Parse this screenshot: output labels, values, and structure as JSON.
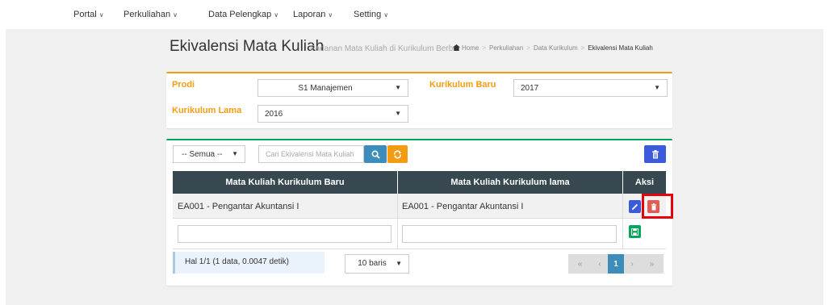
{
  "nav": {
    "items": [
      {
        "label": "Portal"
      },
      {
        "label": "Perkuliahan"
      },
      {
        "label": "Data Pelengkap"
      },
      {
        "label": "Laporan"
      },
      {
        "label": "Setting"
      }
    ]
  },
  "header": {
    "title": "Ekivalensi Mata Kuliah",
    "subtitle": "Padanan Mata Kuliah di Kurikulum Berbeda"
  },
  "breadcrumb": [
    "Home",
    "Perkuliahan",
    "Data Kurikulum",
    "Ekivalensi Mata Kuliah"
  ],
  "filters": {
    "prodi_label": "Prodi",
    "prodi_value": "S1 Manajemen",
    "kurikulum_baru_label": "Kurikulum Baru",
    "kurikulum_baru_value": "2017",
    "kurikulum_lama_label": "Kurikulum Lama",
    "kurikulum_lama_value": "2016"
  },
  "toolbar": {
    "filter_value": "-- Semua --",
    "search_placeholder": "Cari Ekivalensi Mata Kuliah",
    "search_icon": "search-icon",
    "refresh_icon": "refresh-icon",
    "delete_all_icon": "trash-icon"
  },
  "table": {
    "columns": [
      "Mata Kuliah Kurikulum Baru",
      "Mata Kuliah Kurikulum lama",
      "Aksi"
    ],
    "rows": [
      {
        "baru": "EA001 - Pengantar Akuntansi I",
        "lama": "EA001 - Pengantar Akuntansi I"
      }
    ]
  },
  "footer": {
    "info": "Hal 1/1 (1 data, 0.0047 detik)",
    "rows_per_page": "10 baris",
    "pager": [
      "«",
      "‹",
      "1",
      "›",
      "»"
    ]
  },
  "colors": {
    "accent_orange": "#f39c12",
    "accent_green": "#00a65a",
    "header_dark": "#374850",
    "highlight_red": "#e8000b"
  }
}
